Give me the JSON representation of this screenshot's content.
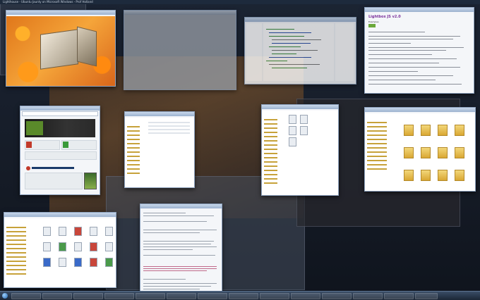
{
  "screen": {
    "topbar_title": "Lighthouse - Ubuntu Jaunty on Microsoft Windows - Prof Holland",
    "doc_window": {
      "heading": "Lightbox JS v2.0",
      "subtitle": "Examples"
    }
  },
  "icons": {
    "start": "windows-orb-icon",
    "folder": "folder-icon",
    "file": "file-icon"
  },
  "colors": {
    "doc_heading": "#7a2f9a",
    "folder": "#d9a733",
    "taskbar": "#1b2636"
  }
}
